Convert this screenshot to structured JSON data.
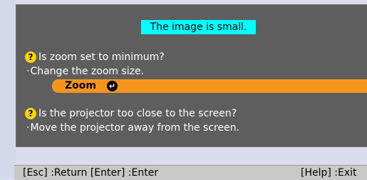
{
  "dialog": {
    "title": "The image is small.",
    "questions": [
      {
        "icon": "question-icon",
        "text": "Is zoom set to minimum?",
        "hint": "Change the zoom size."
      },
      {
        "icon": "question-icon",
        "text": "Is the projector too close to the screen?",
        "hint": "Move the projector away from the screen."
      }
    ],
    "action": {
      "label": "Zoom",
      "icon": "enter-icon"
    }
  },
  "footer": {
    "left": "[Esc] :Return  [Enter] :Enter",
    "right": "[Help] :Exit"
  },
  "colors": {
    "panel": "#5e5e5e",
    "title_bg": "#00ffff",
    "action_bar": "#f7941d",
    "question_icon": "#ffd400"
  }
}
